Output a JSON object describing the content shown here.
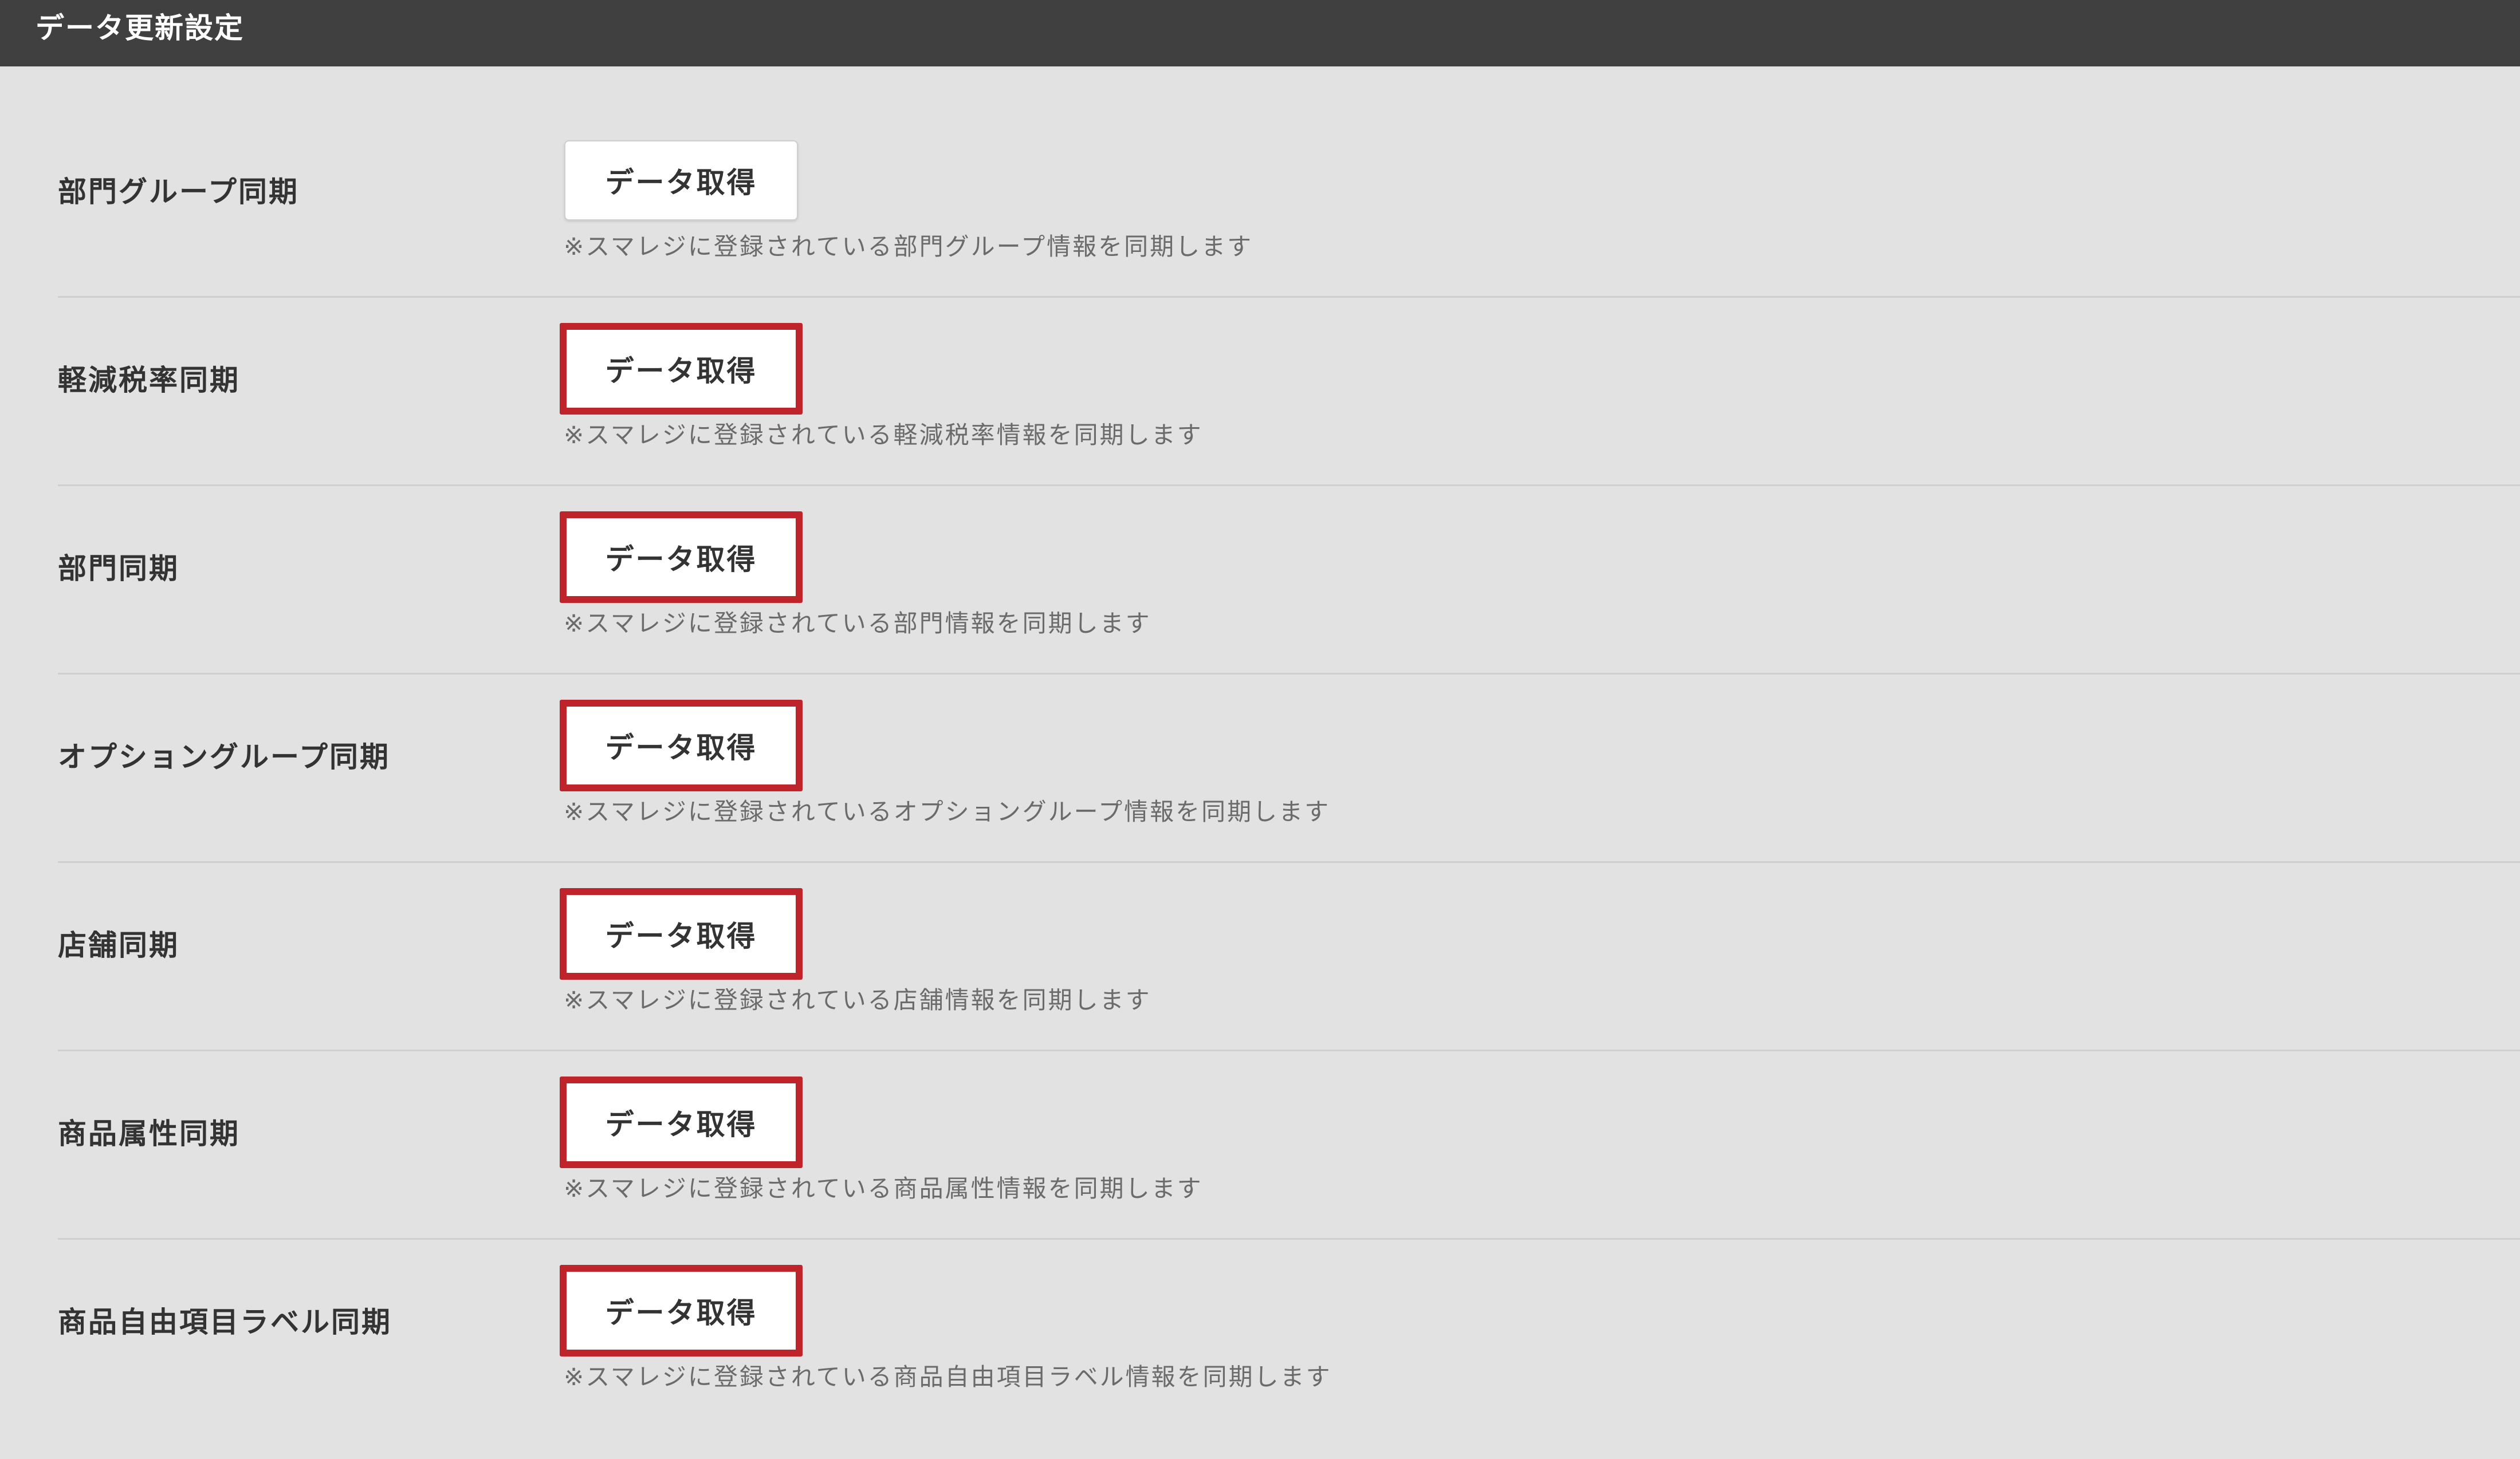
{
  "header": {
    "title": "データ更新設定"
  },
  "rows": [
    {
      "label": "部門グループ同期",
      "button_label": "データ取得",
      "note": "※スマレジに登録されている部門グループ情報を同期します",
      "highlighted": false
    },
    {
      "label": "軽減税率同期",
      "button_label": "データ取得",
      "note": "※スマレジに登録されている軽減税率情報を同期します",
      "highlighted": true
    },
    {
      "label": "部門同期",
      "button_label": "データ取得",
      "note": "※スマレジに登録されている部門情報を同期します",
      "highlighted": true
    },
    {
      "label": "オプショングループ同期",
      "button_label": "データ取得",
      "note": "※スマレジに登録されているオプショングループ情報を同期します",
      "highlighted": true
    },
    {
      "label": "店舗同期",
      "button_label": "データ取得",
      "note": "※スマレジに登録されている店舗情報を同期します",
      "highlighted": true
    },
    {
      "label": "商品属性同期",
      "button_label": "データ取得",
      "note": "※スマレジに登録されている商品属性情報を同期します",
      "highlighted": true
    },
    {
      "label": "商品自由項目ラベル同期",
      "button_label": "データ取得",
      "note": "※スマレジに登録されている商品自由項目ラベル情報を同期します",
      "highlighted": true
    }
  ],
  "colors": {
    "header_bg": "#404040",
    "page_bg": "#e2e2e2",
    "highlight_border": "#c0242b"
  }
}
